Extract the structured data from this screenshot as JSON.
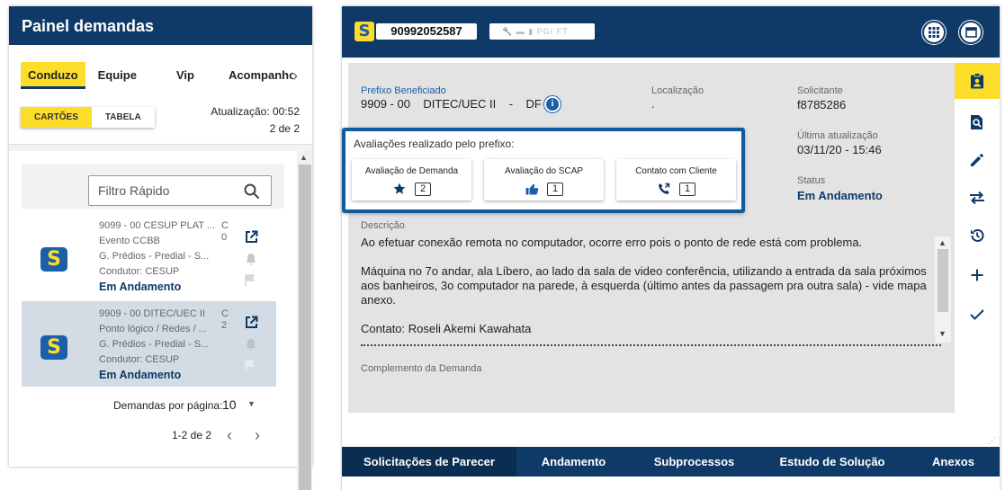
{
  "left_panel": {
    "title": "Painel demandas",
    "tabs": [
      "Conduzo",
      "Equipe",
      "Vip",
      "Acompanho"
    ],
    "view_toggle": [
      "CARTÕES",
      "TABELA"
    ],
    "update_label": "Atualização: 00:52",
    "page_info": "2 de 2",
    "filter_placeholder": "Filtro Rápido",
    "cards": [
      {
        "line1": "9099 - 00 CESUP PLAT ...",
        "line2": "Evento CCBB",
        "line3": "G. Prédios - Predial - S...",
        "line4": "Condutor: CESUP",
        "status": "Em Andamento",
        "cut1": "C",
        "cut2": "0"
      },
      {
        "line1": "9909 - 00 DITEC/UEC II",
        "line2": "Ponto lógico / Redes / ...",
        "line3": "G. Prédios - Predial - S...",
        "line4": "Condutor: CESUP",
        "status": "Em Andamento",
        "cut1": "C",
        "cut2": "2"
      }
    ],
    "per_page_label": "Demandas por página:",
    "per_page_value": "10",
    "range": "1-2 de 2"
  },
  "detail": {
    "demand_number": "90992052587",
    "tool_icons": "PGI FT",
    "prefixo_label": "Prefixo Beneficiado",
    "prefixo_value": "9909 - 00    DITEC/UEC II    -    DF",
    "localizacao_label": "Localização",
    "localizacao_value": ".",
    "solicitante_label": "Solicitante",
    "solicitante_value": "f8785286",
    "ultima_label": "Última atualização",
    "ultima_value": "03/11/20 - 15:46",
    "status_label": "Status",
    "status_value": "Em Andamento",
    "popup": {
      "title": "Avaliações realizado pelo prefixo:",
      "items": [
        {
          "label": "Avaliação de Demanda",
          "count": "2",
          "icon": "star-icon"
        },
        {
          "label": "Avaliação do SCAP",
          "count": "1",
          "icon": "thumbs-up-icon"
        },
        {
          "label": "Contato com Cliente",
          "count": "1",
          "icon": "phone-icon"
        }
      ]
    },
    "descricao_label": "Descrição",
    "descricao": [
      "Ao efetuar conexão remota no computador, ocorre erro pois o ponto de rede está com problema.",
      "Máquina no 7o andar, ala Líbero, ao lado da sala de video conferência, utilizando a entrada da sala próximos aos banheiros, 3o computador na parede, à esquerda (último antes da passagem pra outra sala)  - vide mapa anexo.",
      "Contato: Roseli Akemi Kawahata"
    ],
    "complemento_label": "Complemento da Demanda",
    "bottom_tabs": [
      "Solicitações de Parecer",
      "Andamento",
      "Subprocessos",
      "Estudo de Solução",
      "Anexos"
    ]
  },
  "colors": {
    "navy": "#0f3a68",
    "yellow": "#fbdd2a",
    "blue": "#1c5ea8"
  }
}
